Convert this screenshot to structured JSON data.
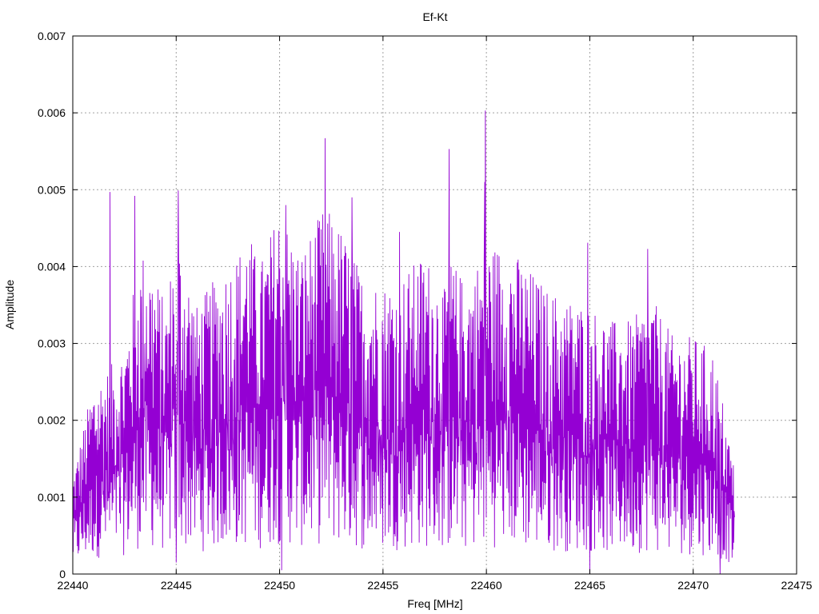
{
  "chart_data": {
    "type": "line",
    "title": "Ef-Kt",
    "xlabel": "Freq [MHz]",
    "ylabel": "Amplitude",
    "xlim": [
      22440,
      22475
    ],
    "ylim": [
      0,
      0.007
    ],
    "grid": true,
    "legend": "none",
    "series_color": "#9400d3",
    "xticks": [
      {
        "value": 22440,
        "label": "22440"
      },
      {
        "value": 22445,
        "label": "22445"
      },
      {
        "value": 22450,
        "label": "22450"
      },
      {
        "value": 22455,
        "label": "22455"
      },
      {
        "value": 22460,
        "label": "22460"
      },
      {
        "value": 22465,
        "label": "22465"
      },
      {
        "value": 22470,
        "label": "22470"
      },
      {
        "value": 22475,
        "label": "22475"
      }
    ],
    "yticks": [
      {
        "value": 0,
        "label": "0"
      },
      {
        "value": 0.001,
        "label": "0.001"
      },
      {
        "value": 0.002,
        "label": "0.002"
      },
      {
        "value": 0.003,
        "label": "0.003"
      },
      {
        "value": 0.004,
        "label": "0.004"
      },
      {
        "value": 0.005,
        "label": "0.005"
      },
      {
        "value": 0.006,
        "label": "0.006"
      },
      {
        "value": 0.007,
        "label": "0.007"
      }
    ],
    "x_range_data": [
      22440.0,
      22472.0
    ],
    "envelope": {
      "x": [
        22440,
        22441,
        22441.8,
        22442.5,
        22443,
        22443.5,
        22444.5,
        22445,
        22446,
        22447,
        22448,
        22448.5,
        22449,
        22450,
        22451,
        22452,
        22452.2,
        22453,
        22454,
        22455,
        22456,
        22457,
        22458,
        22458.3,
        22459,
        22460,
        22461,
        22462,
        22463,
        22464,
        22465,
        22466,
        22467,
        22468,
        22469,
        22470,
        22471,
        22472
      ],
      "y": [
        0.0013,
        0.0025,
        0.0027,
        0.003,
        0.0038,
        0.0043,
        0.0035,
        0.0045,
        0.0035,
        0.0039,
        0.0042,
        0.0045,
        0.004,
        0.0048,
        0.0042,
        0.0047,
        0.0048,
        0.0045,
        0.0039,
        0.0038,
        0.0039,
        0.0042,
        0.0037,
        0.0041,
        0.0038,
        0.0043,
        0.0043,
        0.004,
        0.0037,
        0.0036,
        0.0035,
        0.0033,
        0.0033,
        0.0036,
        0.0031,
        0.0031,
        0.0029,
        0.0014
      ]
    },
    "peaks": [
      {
        "x": 22441.8,
        "y": 0.00497
      },
      {
        "x": 22443.0,
        "y": 0.00492
      },
      {
        "x": 22445.1,
        "y": 0.00499
      },
      {
        "x": 22450.3,
        "y": 0.0048
      },
      {
        "x": 22452.2,
        "y": 0.00567
      },
      {
        "x": 22458.2,
        "y": 0.00553
      },
      {
        "x": 22459.95,
        "y": 0.00603
      },
      {
        "x": 22459.92,
        "y": 0.0051
      },
      {
        "x": 22453.5,
        "y": 0.0049
      },
      {
        "x": 22455.8,
        "y": 0.00445
      },
      {
        "x": 22464.9,
        "y": 0.00431
      },
      {
        "x": 22467.8,
        "y": 0.00423
      }
    ],
    "troughs": [
      {
        "x": 22445.0,
        "y": 0.00015
      },
      {
        "x": 22450.1,
        "y": 5e-05
      },
      {
        "x": 22465.0,
        "y": 0.0
      },
      {
        "x": 22471.3,
        "y": 0.0
      }
    ],
    "n_points": 1600
  }
}
